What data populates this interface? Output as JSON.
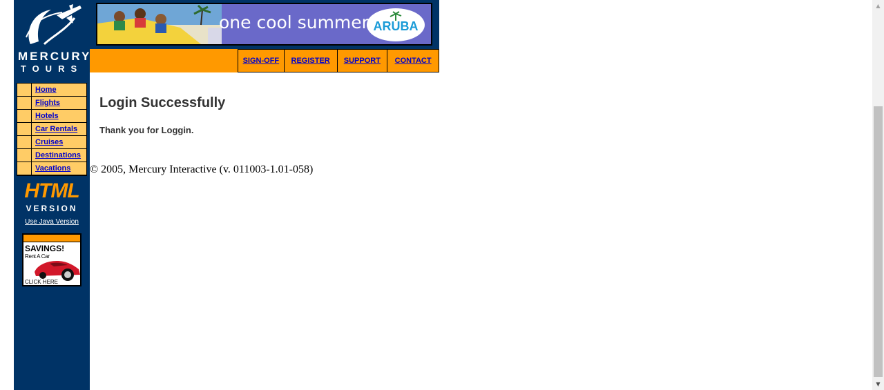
{
  "logo": {
    "line1": "MERCURY",
    "line2": "TOURS"
  },
  "sidebar": {
    "items": [
      {
        "label": "Home"
      },
      {
        "label": "Flights"
      },
      {
        "label": "Hotels"
      },
      {
        "label": "Car Rentals"
      },
      {
        "label": "Cruises"
      },
      {
        "label": "Destinations"
      },
      {
        "label": "Vacations"
      }
    ],
    "html_version": {
      "big": "HTML",
      "small": "VERSION"
    },
    "java_link": "Use Java Version",
    "ad": {
      "headline": "SAVINGS!",
      "sub": "Rent A Car",
      "cta": "CLICK HERE"
    }
  },
  "banner": {
    "text": "one cool summer",
    "badge": "ARUBA"
  },
  "topnav": {
    "items": [
      {
        "label": "SIGN-OFF"
      },
      {
        "label": "REGISTER"
      },
      {
        "label": "SUPPORT"
      },
      {
        "label": "CONTACT"
      }
    ]
  },
  "main": {
    "title": "Login Successfully",
    "message": "Thank you for Loggin."
  },
  "footer": {
    "copyright": "© 2005, Mercury Interactive (v. 011003-1.01-058)"
  },
  "colors": {
    "navy": "#003366",
    "orange": "#ff9900",
    "light_orange": "#ffcc66",
    "link": "#0000cc"
  }
}
